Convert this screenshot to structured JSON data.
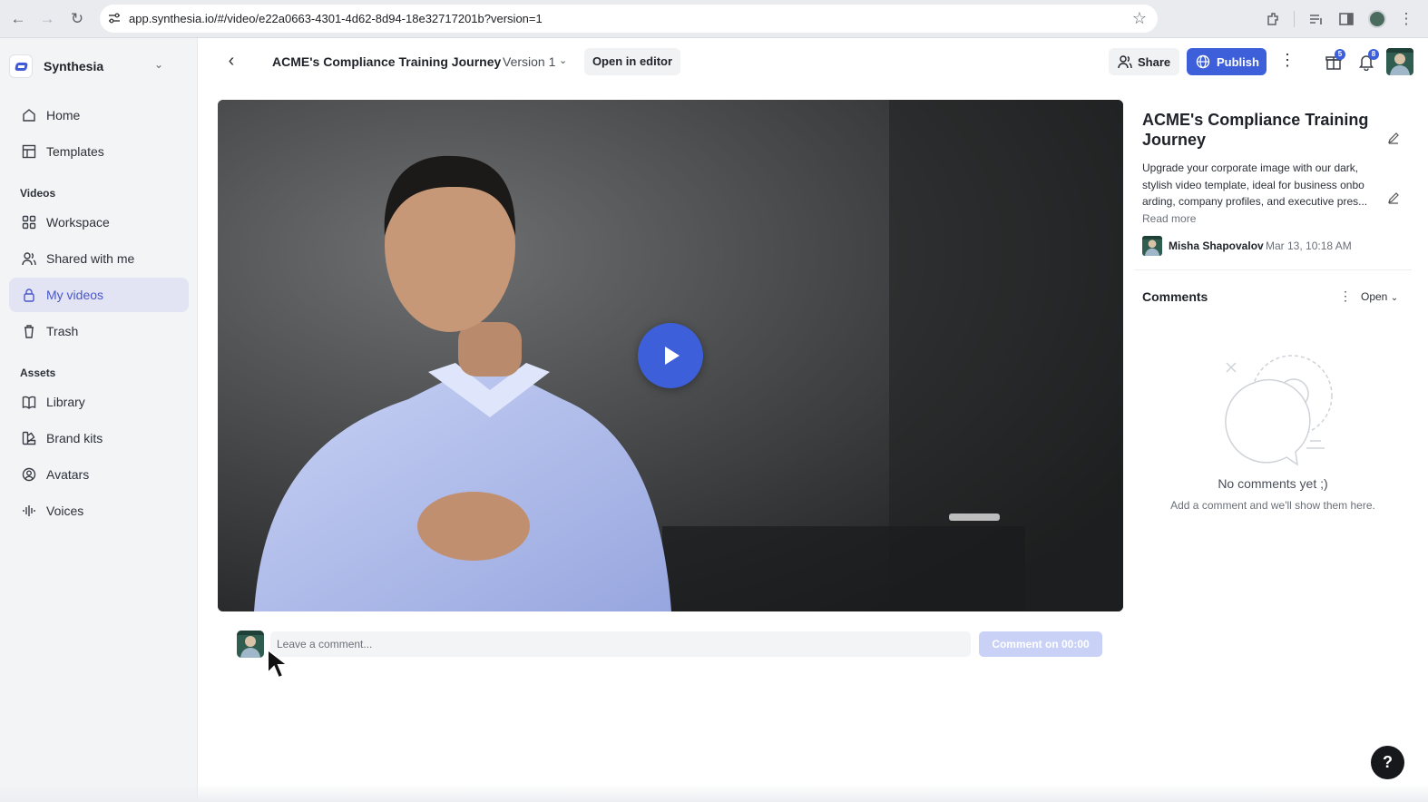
{
  "browser": {
    "url": "app.synthesia.io/#/video/e22a0663-4301-4d62-8d94-18e32717201b?version=1"
  },
  "sidebar": {
    "workspace_name": "Synthesia",
    "items_top": [
      {
        "label": "Home",
        "icon": "home-icon"
      },
      {
        "label": "Templates",
        "icon": "templates-icon"
      }
    ],
    "section_videos": "Videos",
    "items_videos": [
      {
        "label": "Workspace",
        "icon": "workspace-icon"
      },
      {
        "label": "Shared with me",
        "icon": "shared-icon"
      },
      {
        "label": "My videos",
        "icon": "lock-icon",
        "active": true
      },
      {
        "label": "Trash",
        "icon": "trash-icon"
      }
    ],
    "section_assets": "Assets",
    "items_assets": [
      {
        "label": "Library",
        "icon": "library-icon"
      },
      {
        "label": "Brand kits",
        "icon": "brand-kits-icon"
      },
      {
        "label": "Avatars",
        "icon": "avatars-icon"
      },
      {
        "label": "Voices",
        "icon": "voices-icon"
      }
    ]
  },
  "topbar": {
    "title": "ACME's Compliance Training Journey",
    "version": "Version 1",
    "open_editor": "Open in editor",
    "share": "Share",
    "publish": "Publish",
    "gifts_badge": "5",
    "notifications_badge": "8"
  },
  "details": {
    "title": "ACME's Compliance Training Journey",
    "description": "Upgrade your corporate image with our dark, stylish video template, ideal for business onbo arding, company profiles, and executive pres...",
    "read_more": "Read more",
    "author": "Misha Shapovalov",
    "date": "Mar 13, 10:18 AM"
  },
  "comments": {
    "header": "Comments",
    "filter": "Open",
    "empty_title": "No comments yet ;)",
    "empty_subtitle": "Add a comment and we'll show them here.",
    "input_placeholder": "Leave a comment...",
    "submit_label": "Comment on 00:00"
  },
  "help_label": "?",
  "colors": {
    "accent": "#3d5fd9",
    "sidebar_bg": "#f3f4f6",
    "active_item": "#e2e4f3"
  }
}
